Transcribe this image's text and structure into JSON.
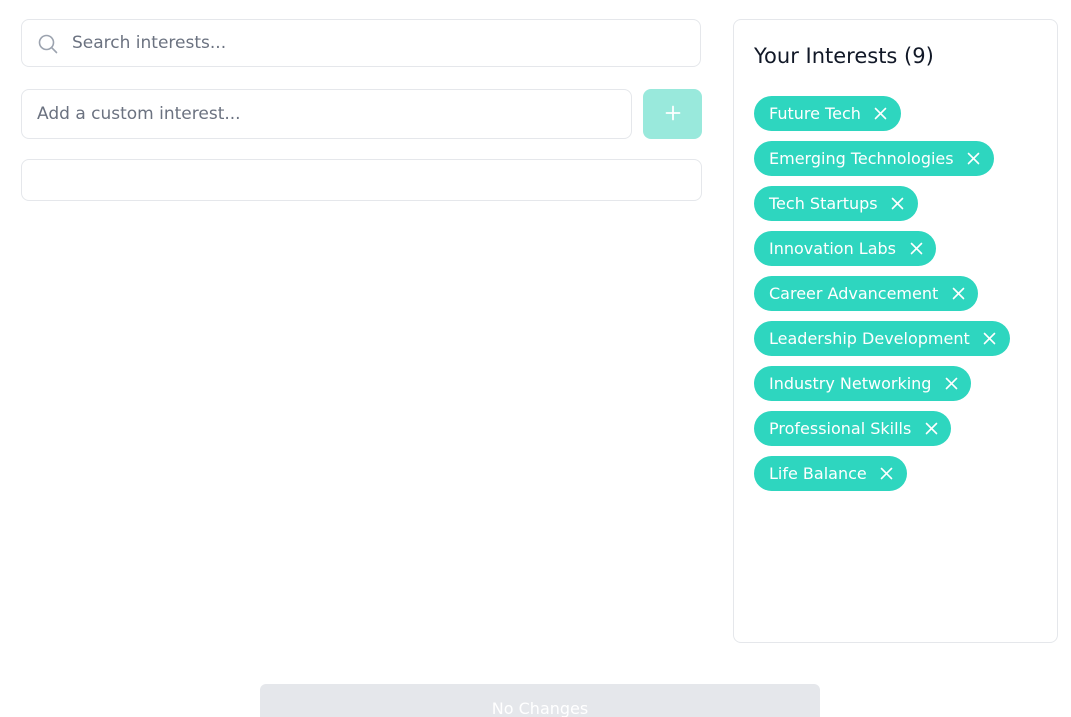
{
  "search": {
    "placeholder": "Search interests...",
    "value": "",
    "icon": "search-icon"
  },
  "custom_interest": {
    "placeholder": "Add a custom interest...",
    "value": "",
    "add_button_label": "+"
  },
  "interests_panel": {
    "title": "Your Interests (9)",
    "tags": [
      {
        "label": "Future Tech"
      },
      {
        "label": "Emerging Technologies"
      },
      {
        "label": "Tech Startups"
      },
      {
        "label": "Innovation Labs"
      },
      {
        "label": "Career Advancement"
      },
      {
        "label": "Leadership Development"
      },
      {
        "label": "Industry Networking"
      },
      {
        "label": "Professional Skills"
      },
      {
        "label": "Life Balance"
      }
    ],
    "remove_icon": "close-icon"
  },
  "footer": {
    "submit_label": "No Changes"
  },
  "colors": {
    "accent": "#2ed6bf",
    "accent_disabled": "#99e9dc",
    "border": "#e5e7eb",
    "disabled_button": "#e5e7eb"
  }
}
